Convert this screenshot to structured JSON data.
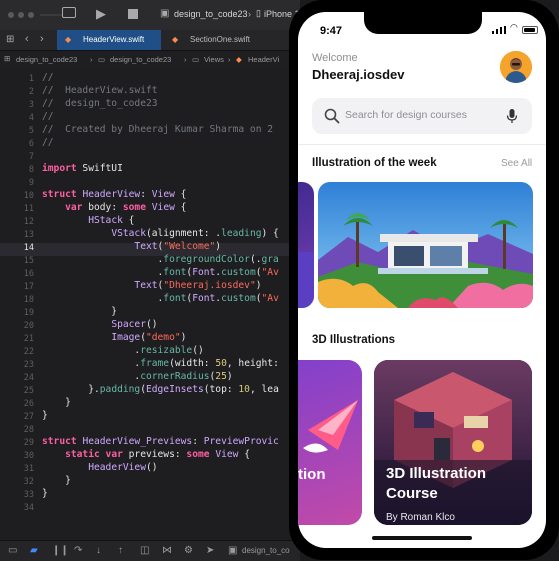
{
  "xcode": {
    "tabs": {
      "active": "HeaderView.swift",
      "second": "SectionOne.swift"
    },
    "run_destination": "iPhone 1",
    "scheme": "design_to_code23",
    "breadcrumb": [
      "design_to_code23",
      "design_to_code23",
      "Views",
      "HeaderVi"
    ],
    "status_scheme": "design_to_co",
    "line_numbers": [
      "1",
      "2",
      "3",
      "4",
      "5",
      "6",
      "7",
      "8",
      "9",
      "10",
      "11",
      "12",
      "13",
      "14",
      "15",
      "16",
      "17",
      "18",
      "19",
      "20",
      "21",
      "22",
      "23",
      "24",
      "25",
      "26",
      "27",
      "28",
      "29",
      "30",
      "31",
      "32",
      "33",
      "34"
    ],
    "current_line": "14"
  },
  "app": {
    "status_time": "9:47",
    "greeting": "Welcome",
    "username": "Dheeraj.iosdev",
    "search_placeholder": "Search for design courses",
    "section1_title": "Illustration of the week",
    "see_all": "See All",
    "section2_title": "3D Illustrations",
    "course_left_fragment": "tion",
    "course_title": "3D Illustration Course",
    "course_author": "By Roman Klco"
  },
  "colors": {
    "accent_blue": "#1f4f86",
    "keyword": "#fc5fa3",
    "string": "#fc6a5d",
    "type": "#d0a8ff",
    "comment": "#74797f"
  }
}
